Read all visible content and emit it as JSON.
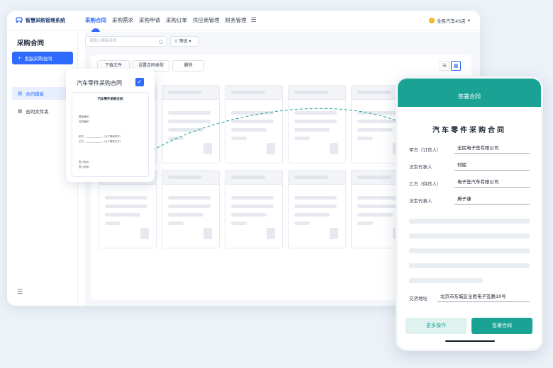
{
  "app": {
    "name": "智慧采购管理系统"
  },
  "nav": {
    "items": [
      "采购合同",
      "采购需求",
      "采购申请",
      "采购订单",
      "供应商管理",
      "财务管理"
    ],
    "active": 0
  },
  "company": "全民汽车4S店",
  "sidebar": {
    "title": "采购合同",
    "launch": "发起采购合同",
    "items": [
      "合同模板",
      "合同文件夹"
    ],
    "active": 0
  },
  "toolbar": {
    "search_placeholder": "请输入模板名称",
    "filter": "筛选",
    "download": "下载文件",
    "set_type": "设置合同类型",
    "delete": "删除"
  },
  "doc": {
    "title": "汽车零件采购合同",
    "sheet_title": "汽车零件采购合同",
    "fields": [
      "模板编号：",
      "合同编号：",
      "甲方：_____________（以下简称甲方）",
      "乙方：_____________（以下简称乙方）",
      "签订地点：",
      "签订时间："
    ]
  },
  "phone": {
    "header": "签署合同",
    "title": "汽车零件采购合同",
    "rows": [
      {
        "label": "甲方（订货人）",
        "value": "全民电子签有限公司"
      },
      {
        "label": "法定代表人",
        "value": "何妮"
      },
      {
        "label": "乙方（供货人）",
        "value": "电子签汽车有限公司"
      },
      {
        "label": "法定代表人",
        "value": "典子谦"
      }
    ],
    "address": {
      "label": "交货地址",
      "value": "北京市东城区全民电子签路10号"
    },
    "more": "更多操作",
    "sign": "签署合同"
  },
  "colors": {
    "primary": "#2f6bff",
    "teal": "#1aa394"
  }
}
